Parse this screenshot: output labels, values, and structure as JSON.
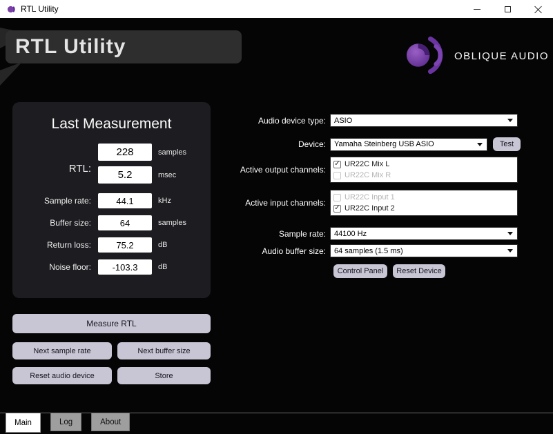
{
  "titlebar": {
    "title": "RTL Utility"
  },
  "header": {
    "title": "RTL Utility",
    "brand": "OBLIQUE AUDIO"
  },
  "colors": {
    "brand_purple": "#7a3fa5",
    "button": "#c8c6d4",
    "panel": "#1d1d21"
  },
  "measurement": {
    "title": "Last Measurement",
    "rtl_label": "RTL:",
    "rtl_samples": "228",
    "rtl_samples_unit": "samples",
    "rtl_msec": "5.2",
    "rtl_msec_unit": "msec",
    "fields": [
      {
        "label": "Sample rate:",
        "value": "44.1",
        "unit": "kHz"
      },
      {
        "label": "Buffer size:",
        "value": "64",
        "unit": "samples"
      },
      {
        "label": "Return loss:",
        "value": "75.2",
        "unit": "dB"
      },
      {
        "label": "Noise floor:",
        "value": "-103.3",
        "unit": "dB"
      }
    ]
  },
  "actions": {
    "measure_rtl": "Measure RTL",
    "next_sample_rate": "Next sample rate",
    "next_buffer_size": "Next buffer size",
    "reset_audio_device": "Reset audio device",
    "store": "Store"
  },
  "device_form": {
    "device_type": {
      "label": "Audio device type:",
      "value": "ASIO"
    },
    "device": {
      "label": "Device:",
      "value": "Yamaha Steinberg USB ASIO"
    },
    "test_button": "Test",
    "output_channels": {
      "label": "Active output channels:",
      "items": [
        {
          "name": "UR22C Mix L",
          "checked": true
        },
        {
          "name": "UR22C Mix R",
          "checked": false
        }
      ]
    },
    "input_channels": {
      "label": "Active input channels:",
      "items": [
        {
          "name": "UR22C Input 1",
          "checked": false
        },
        {
          "name": "UR22C Input 2",
          "checked": true
        }
      ]
    },
    "sample_rate": {
      "label": "Sample rate:",
      "value": "44100 Hz"
    },
    "buffer_size": {
      "label": "Audio buffer size:",
      "value": "64 samples (1.5 ms)"
    },
    "control_panel": "Control Panel",
    "reset_device": "Reset Device"
  },
  "tabs": [
    {
      "label": "Main",
      "active": true
    },
    {
      "label": "Log",
      "active": false
    },
    {
      "label": "About",
      "active": false
    }
  ]
}
